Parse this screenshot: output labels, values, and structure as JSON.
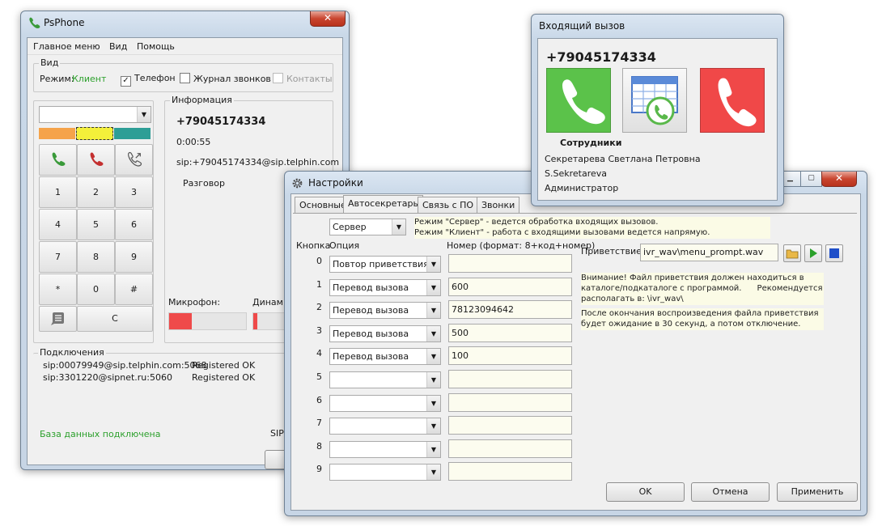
{
  "psphone": {
    "title": "PsPhone",
    "close": "✕",
    "menu": [
      "Главное меню",
      "Вид",
      "Помощь"
    ],
    "view_group": {
      "title": "Вид",
      "mode_label": "Режим:",
      "mode_value": "Клиент",
      "checks": [
        {
          "label": "Телефон",
          "checked": true
        },
        {
          "label": "Журнал звонков",
          "checked": false
        },
        {
          "label": "Контакты",
          "checked": false
        }
      ]
    },
    "keypad": {
      "keys": [
        "1",
        "2",
        "3",
        "4",
        "5",
        "6",
        "7",
        "8",
        "9",
        "*",
        "0",
        "#"
      ],
      "clear": "C"
    },
    "info": {
      "title": "Информация",
      "number": "+79045174334",
      "time": "0:00:55",
      "sip": "sip:+79045174334@sip.telphin.com",
      "status": "Разговор",
      "mic_label": "Микрофон:",
      "spk_label": "Динами"
    },
    "connections": {
      "title": "Подключения",
      "rows": [
        {
          "account": "sip:00079949@sip.telphin.com:5068",
          "state": "Registered OK"
        },
        {
          "account": "sip:3301220@sipnet.ru:5060",
          "state": "Registered OK"
        }
      ],
      "db": "База данных подключена",
      "sip_trunc": "SIP"
    }
  },
  "incoming": {
    "title": "Входящий вызов",
    "number": "+79045174334",
    "group": "Сотрудники",
    "name": "Секретарева Светлана Петровна",
    "login": "S.Sekretareva",
    "role": "Администратор"
  },
  "settings": {
    "title": "Настройки",
    "tabs": [
      "Основные",
      "Автосекретарь",
      "Связь с ПО",
      "Звонки"
    ],
    "mode_value": "Сервер",
    "mode_note_1": "Режим \"Сервер\" - ведется обработка входящих вызовов.",
    "mode_note_2": "Режим \"Клиент\" - работа с входящими вызовами ведется напрямую.",
    "col_key": "Кнопка",
    "col_option": "Опция",
    "col_number": "Номер (формат: 8+код+номер)",
    "rows": [
      {
        "key": "0",
        "option": "Повтор приветствия",
        "number": ""
      },
      {
        "key": "1",
        "option": "Перевод вызова",
        "number": "600"
      },
      {
        "key": "2",
        "option": "Перевод вызова",
        "number": "78123094642"
      },
      {
        "key": "3",
        "option": "Перевод вызова",
        "number": "500"
      },
      {
        "key": "4",
        "option": "Перевод вызова",
        "number": "100"
      },
      {
        "key": "5",
        "option": "",
        "number": ""
      },
      {
        "key": "6",
        "option": "",
        "number": ""
      },
      {
        "key": "7",
        "option": "",
        "number": ""
      },
      {
        "key": "8",
        "option": "",
        "number": ""
      },
      {
        "key": "9",
        "option": "",
        "number": ""
      }
    ],
    "greeting_label": "Приветствие:",
    "greeting_value": "ivr_wav\\menu_prompt.wav",
    "warn_1": "Внимание! Файл приветствия должен находиться в",
    "warn_2": "каталоге/подкаталоге с программой.      Рекомендуется",
    "warn_3": "располагать в: \\ivr_wav\\",
    "after_1": "После окончания воспроизведения файла приветствия",
    "after_2": "будет ожидание в 30 секунд, а потом отключение.",
    "ok": "OK",
    "cancel": "Отмена",
    "apply": "Применить"
  },
  "colors": {
    "accept": "#5bc24a",
    "reject": "#f04848",
    "status_green": "#2ca02c",
    "swatch_orange": "#f5a34a",
    "swatch_yellow": "#f4f03a",
    "swatch_teal": "#2e9e96"
  }
}
